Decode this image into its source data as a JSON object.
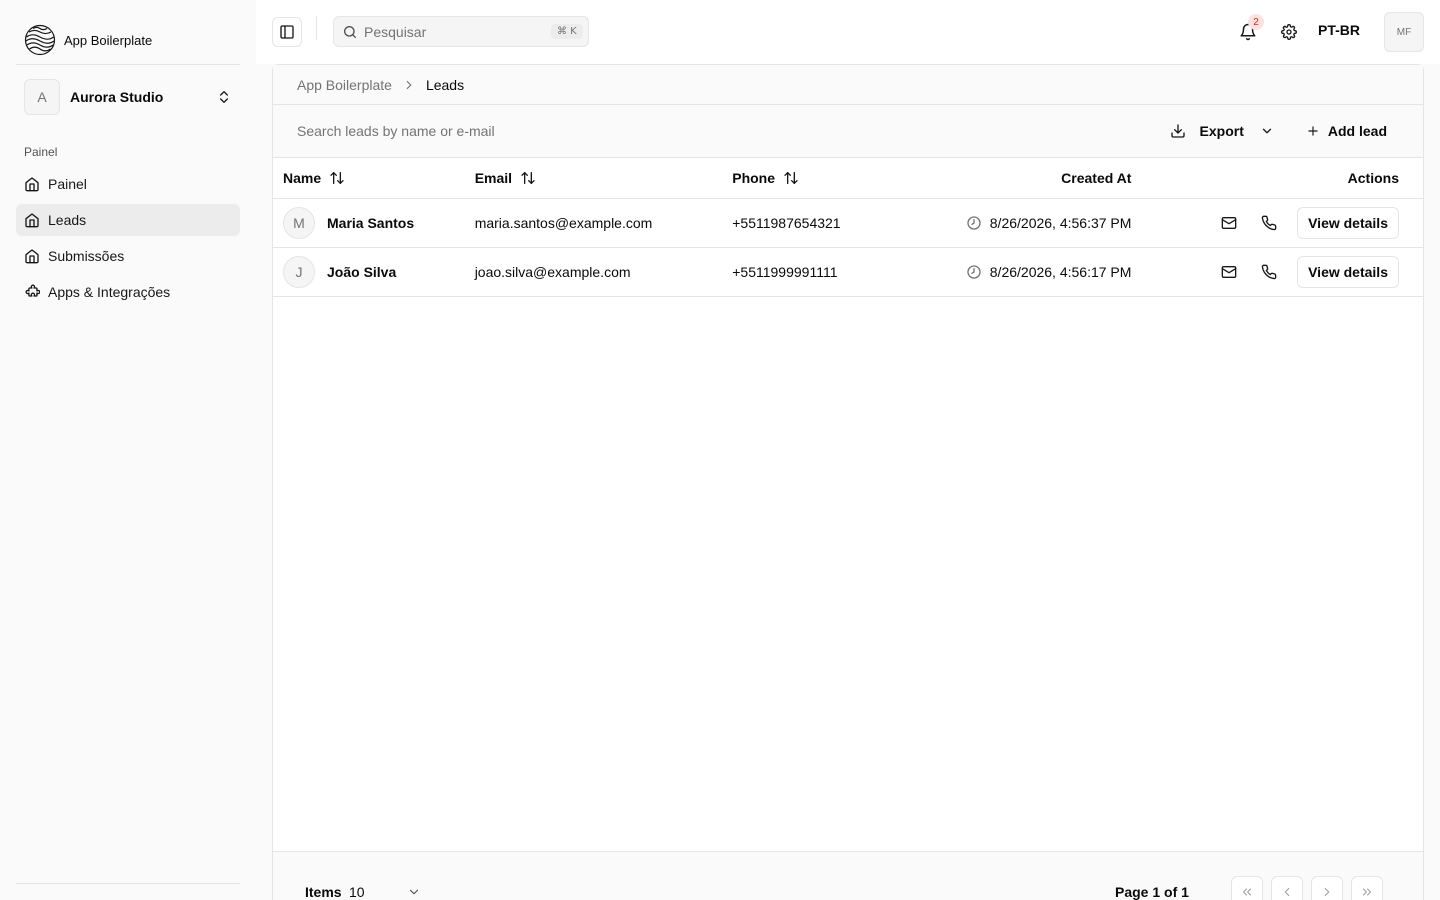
{
  "sidebar": {
    "brand": "App Boilerplate",
    "workspace": {
      "initial": "A",
      "name": "Aurora Studio"
    },
    "group_label": "Painel",
    "items": [
      {
        "label": "Painel",
        "icon": "home-icon"
      },
      {
        "label": "Leads",
        "icon": "home-icon",
        "active": true
      },
      {
        "label": "Submissões",
        "icon": "home-icon"
      },
      {
        "label": "Apps & Integrações",
        "icon": "puzzle-icon"
      }
    ]
  },
  "topbar": {
    "search_placeholder": "Pesquisar",
    "search_shortcut": "⌘ K",
    "notification_count": "2",
    "language": "PT-BR",
    "user_initials": "MF"
  },
  "breadcrumb": {
    "root": "App Boilerplate",
    "current": "Leads"
  },
  "toolbar": {
    "search_placeholder": "Search leads by name or e-mail",
    "export_label": "Export",
    "add_label": "Add lead"
  },
  "table": {
    "columns": {
      "name": "Name",
      "email": "Email",
      "phone": "Phone",
      "created": "Created At",
      "actions": "Actions"
    },
    "rows": [
      {
        "initial": "M",
        "name": "Maria Santos",
        "email": "maria.santos@example.com",
        "phone": "+5511987654321",
        "created": "8/26/2026, 4:56:37 PM",
        "action_label": "View details"
      },
      {
        "initial": "J",
        "name": "João Silva",
        "email": "joao.silva@example.com",
        "phone": "+5511999991111",
        "created": "8/26/2026, 4:56:17 PM",
        "action_label": "View details"
      }
    ]
  },
  "footer": {
    "items_label": "Items",
    "items_value": "10",
    "page_label": "Page 1 of 1"
  },
  "colors": {
    "accent_badge_bg": "#fde2e2",
    "accent_badge_text": "#dc2626"
  }
}
